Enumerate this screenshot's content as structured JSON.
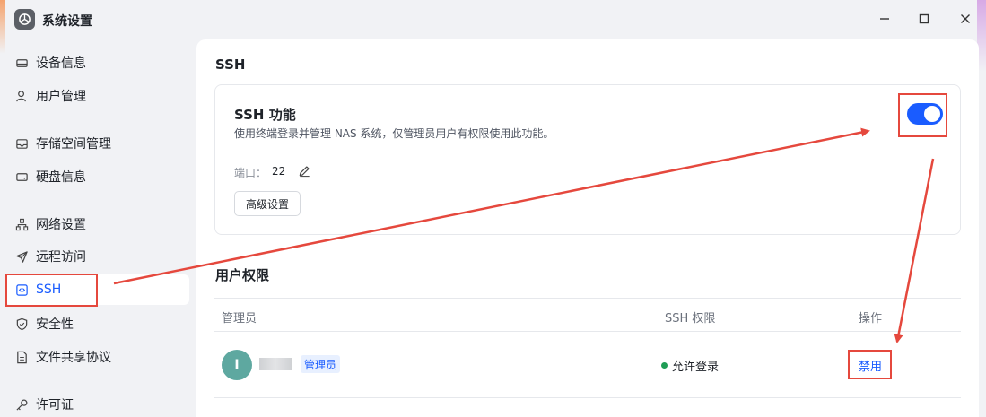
{
  "window": {
    "title": "系统设置",
    "app_icon": "settings-app-icon",
    "controls": [
      "minimize-icon",
      "maximize-icon",
      "close-icon"
    ]
  },
  "sidebar": {
    "items": [
      {
        "label": "设备信息",
        "icon": "drive-icon"
      },
      {
        "label": "用户管理",
        "icon": "user-icon"
      },
      {
        "label": "存储空间管理",
        "icon": "storage-icon"
      },
      {
        "label": "硬盘信息",
        "icon": "disk-icon"
      },
      {
        "label": "网络设置",
        "icon": "network-icon"
      },
      {
        "label": "远程访问",
        "icon": "send-icon"
      },
      {
        "label": "SSH",
        "icon": "code-icon",
        "active": true
      },
      {
        "label": "安全性",
        "icon": "shield-icon"
      },
      {
        "label": "文件共享协议",
        "icon": "file-icon"
      },
      {
        "label": "许可证",
        "icon": "key-icon"
      }
    ]
  },
  "main": {
    "section_title": "SSH",
    "ssh_card": {
      "title": "SSH 功能",
      "description": "使用终端登录并管理 NAS 系统，仅管理员用户有权限使用此功能。",
      "port_label": "端口：",
      "port_value": "22",
      "advanced_button": "高级设置",
      "enabled": true
    },
    "permissions": {
      "title": "用户权限",
      "columns": [
        "管理员",
        "SSH 权限",
        "操作"
      ],
      "rows": [
        {
          "avatar_letter": "I",
          "badge": "管理员",
          "status": "允许登录",
          "action": "禁用"
        }
      ]
    }
  },
  "colors": {
    "accent": "#1a5cff",
    "annotation": "#e5483d",
    "status_ok": "#1f9d55"
  }
}
